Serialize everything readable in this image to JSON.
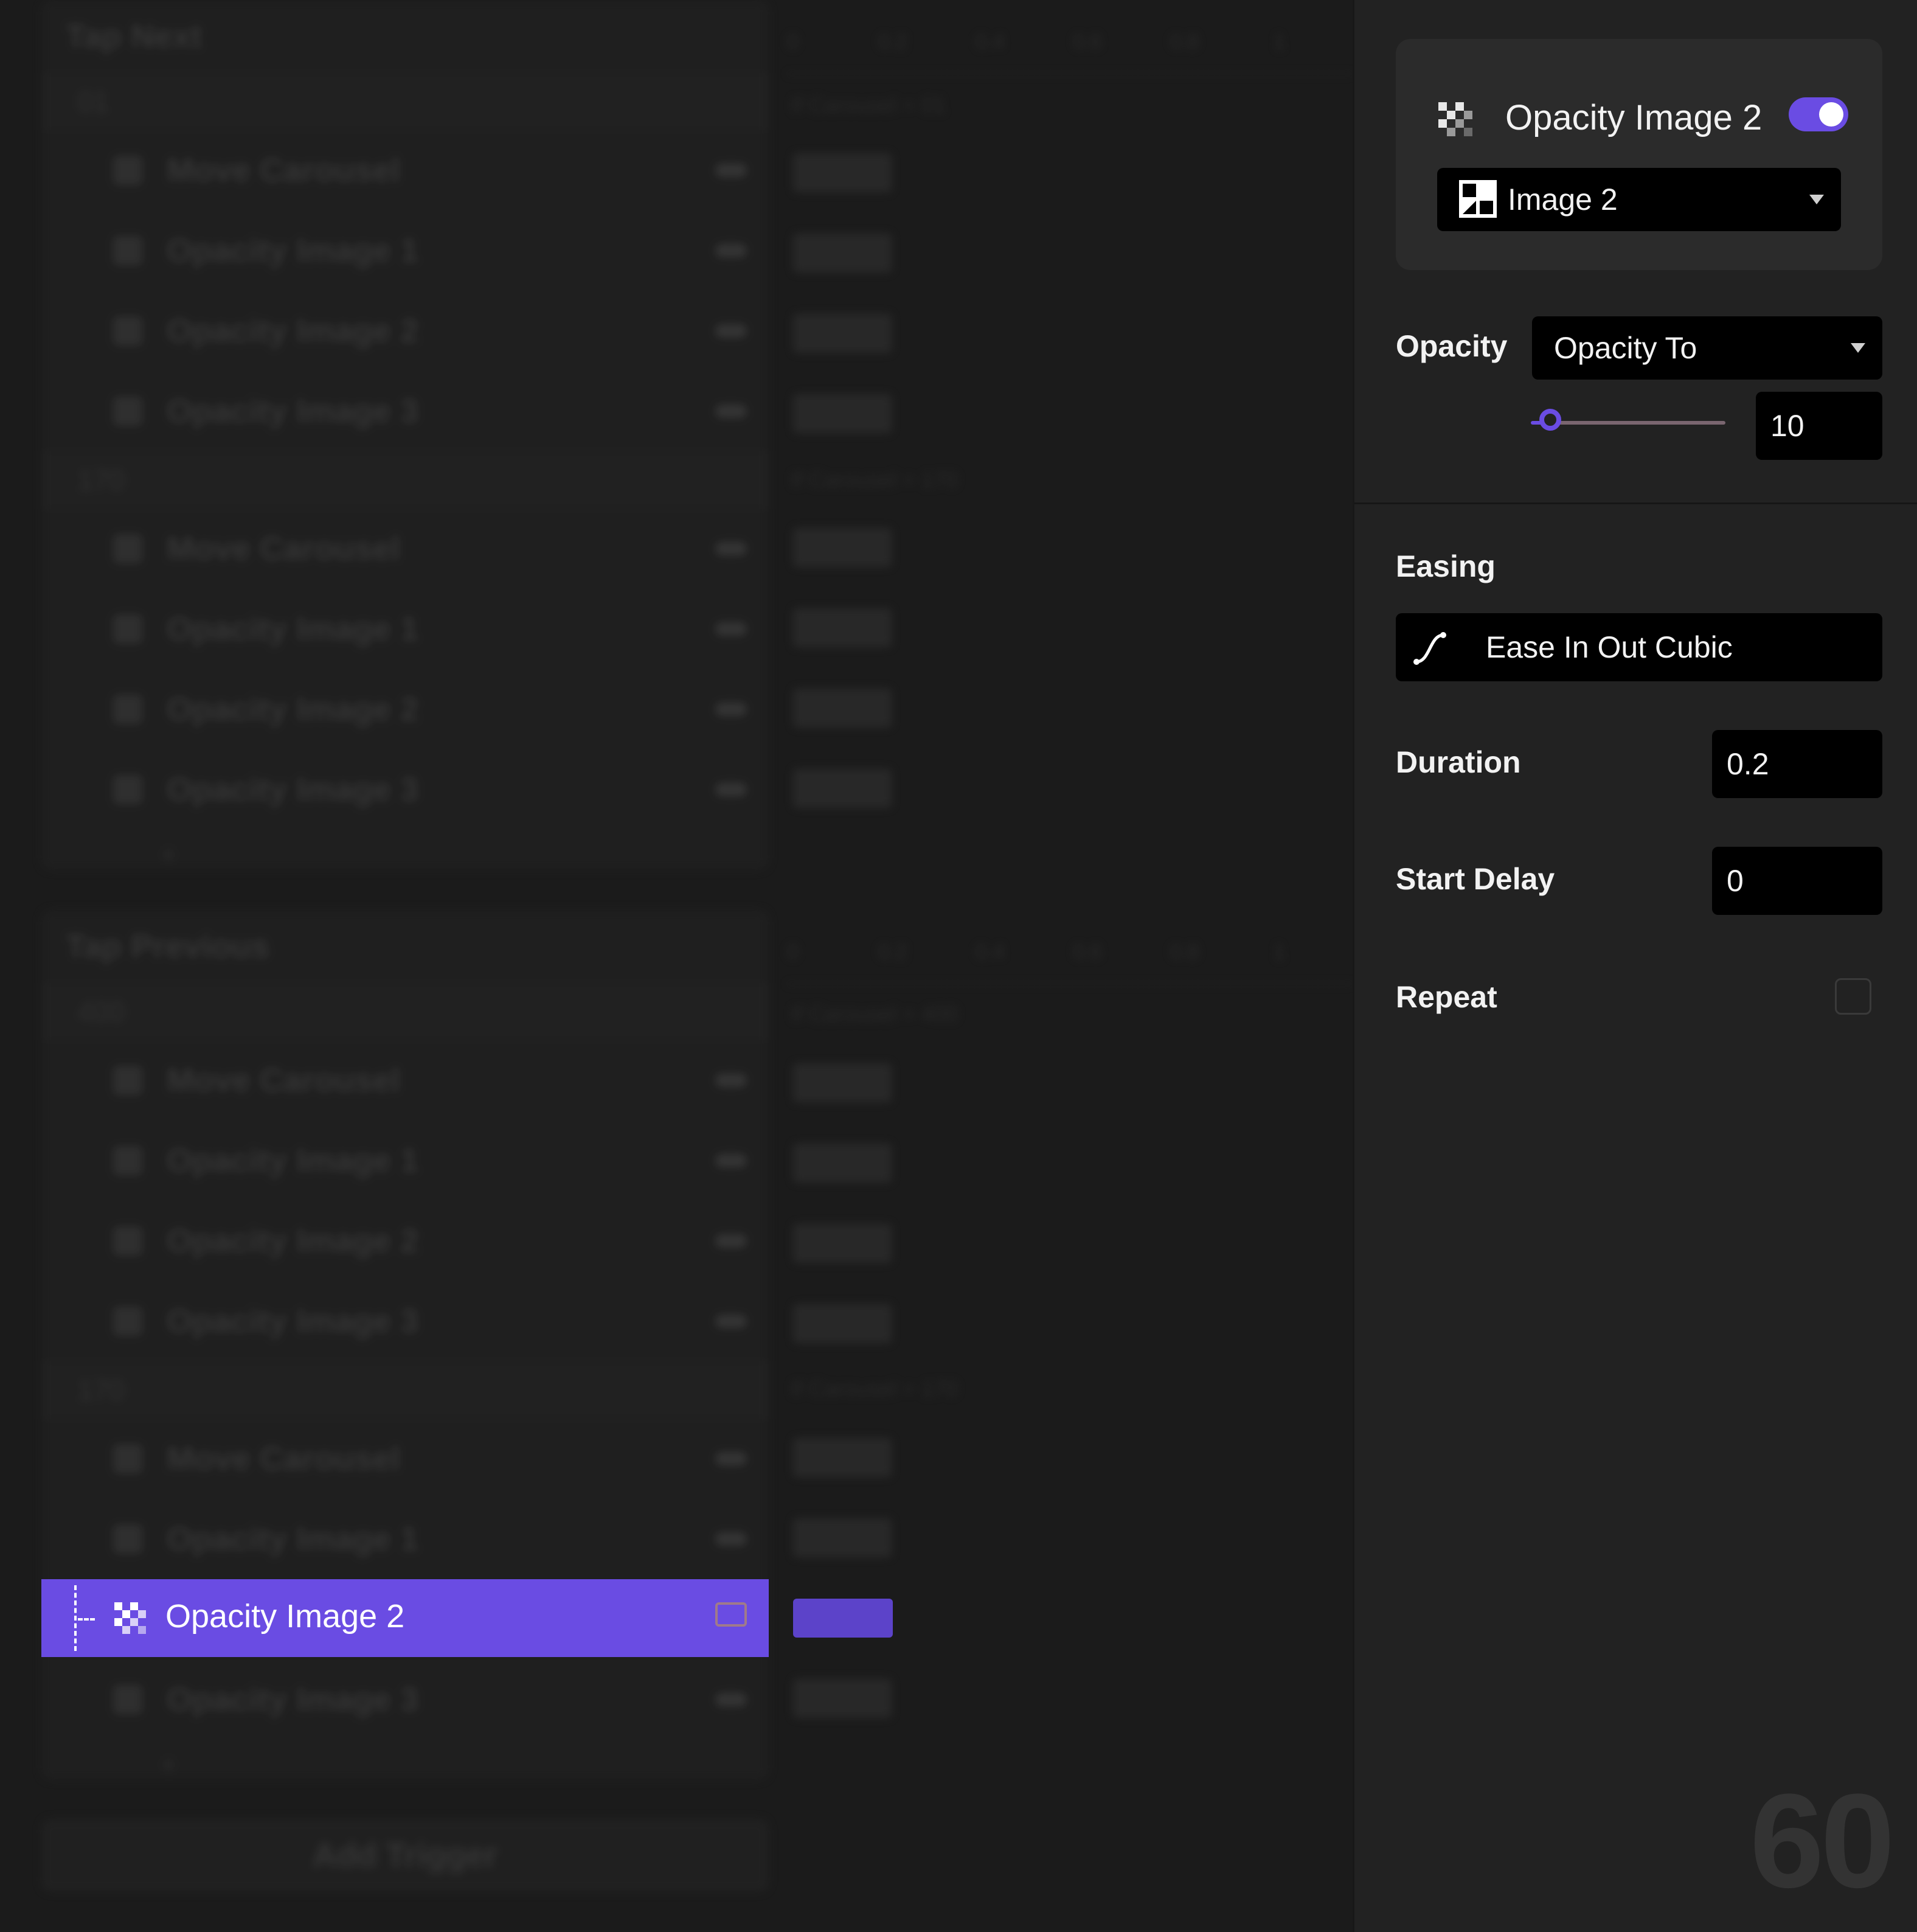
{
  "timeline": {
    "groups": [
      {
        "title": "Tap Next",
        "sub": [
          {
            "label": "01",
            "caption": "If Carousel = 01",
            "rows": [
              "Move Carousel",
              "Opacity Image 1",
              "Opacity Image 2",
              "Opacity Image 3"
            ]
          },
          {
            "label": "170",
            "caption": "If Carousel = 170",
            "rows": [
              "Move Carousel",
              "Opacity Image 1",
              "Opacity Image 2",
              "Opacity Image 3"
            ]
          }
        ]
      },
      {
        "title": "Tap Previous",
        "sub": [
          {
            "label": "400",
            "caption": "If Carousel = 400",
            "rows": [
              "Move Carousel",
              "Opacity Image 1",
              "Opacity Image 2",
              "Opacity Image 3"
            ]
          },
          {
            "label": "170",
            "caption": "If Carousel = 170",
            "rows": [
              "Move Carousel",
              "Opacity Image 1"
            ]
          }
        ]
      }
    ],
    "ruler": [
      "0",
      "0.2",
      "0.4",
      "0.6",
      "0.8",
      "1"
    ],
    "selected_row_label": "Opacity Image 2",
    "after_selected_row": "Opacity Image 3",
    "add_trigger": "Add Trigger"
  },
  "inspector": {
    "card": {
      "title": "Opacity Image 2",
      "enabled": true,
      "target_value": "Image 2"
    },
    "opacity": {
      "label": "Opacity",
      "mode": "Opacity To",
      "value": "10",
      "slider_fraction": 0.1
    },
    "easing": {
      "label": "Easing",
      "value": "Ease In Out Cubic"
    },
    "duration": {
      "label": "Duration",
      "value": "0.2"
    },
    "start_delay": {
      "label": "Start Delay",
      "value": "0"
    },
    "repeat": {
      "label": "Repeat",
      "checked": false
    },
    "fps": "60"
  },
  "colors": {
    "accent": "#6a4ce3",
    "panel": "#222222",
    "field": "#000000"
  }
}
